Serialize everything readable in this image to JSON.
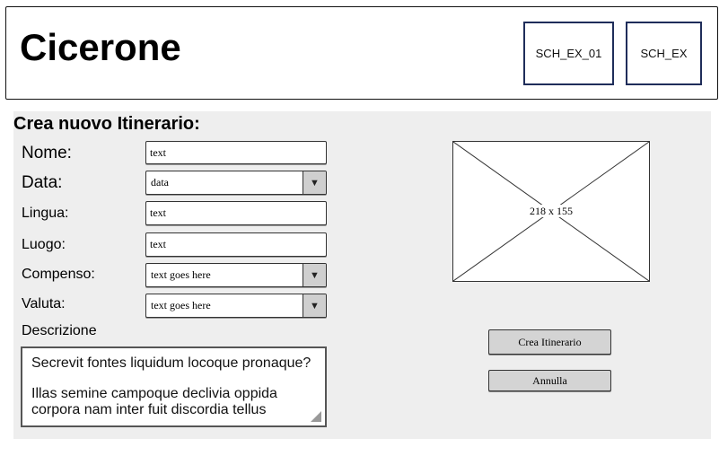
{
  "header": {
    "app_title": "Cicerone",
    "buttons": [
      "SCH_EX_01",
      "SCH_EX"
    ]
  },
  "form": {
    "title": "Crea nuovo Itinerario:",
    "fields": {
      "nome": {
        "label": "Nome:",
        "value": "text"
      },
      "data": {
        "label": "Data:",
        "value": "data"
      },
      "lingua": {
        "label": "Lingua:",
        "value": "text"
      },
      "luogo": {
        "label": "Luogo:",
        "value": "text"
      },
      "compenso": {
        "label": "Compenso:",
        "value": "text goes here"
      },
      "valuta": {
        "label": "Valuta:",
        "value": "text goes here"
      }
    },
    "descrizione": {
      "label": "Descrizione",
      "lines": [
        "Secrevit fontes liquidum locoque pronaque?",
        "Illas semine campoque declivia oppida corpora nam inter fuit discordia tellus"
      ]
    }
  },
  "image_placeholder": {
    "label": "218 x 155"
  },
  "actions": {
    "create_label": "Crea Itinerario",
    "cancel_label": "Annulla"
  },
  "icons": {
    "dropdown": "chevron-down-icon",
    "resize": "resize-grip-icon"
  }
}
